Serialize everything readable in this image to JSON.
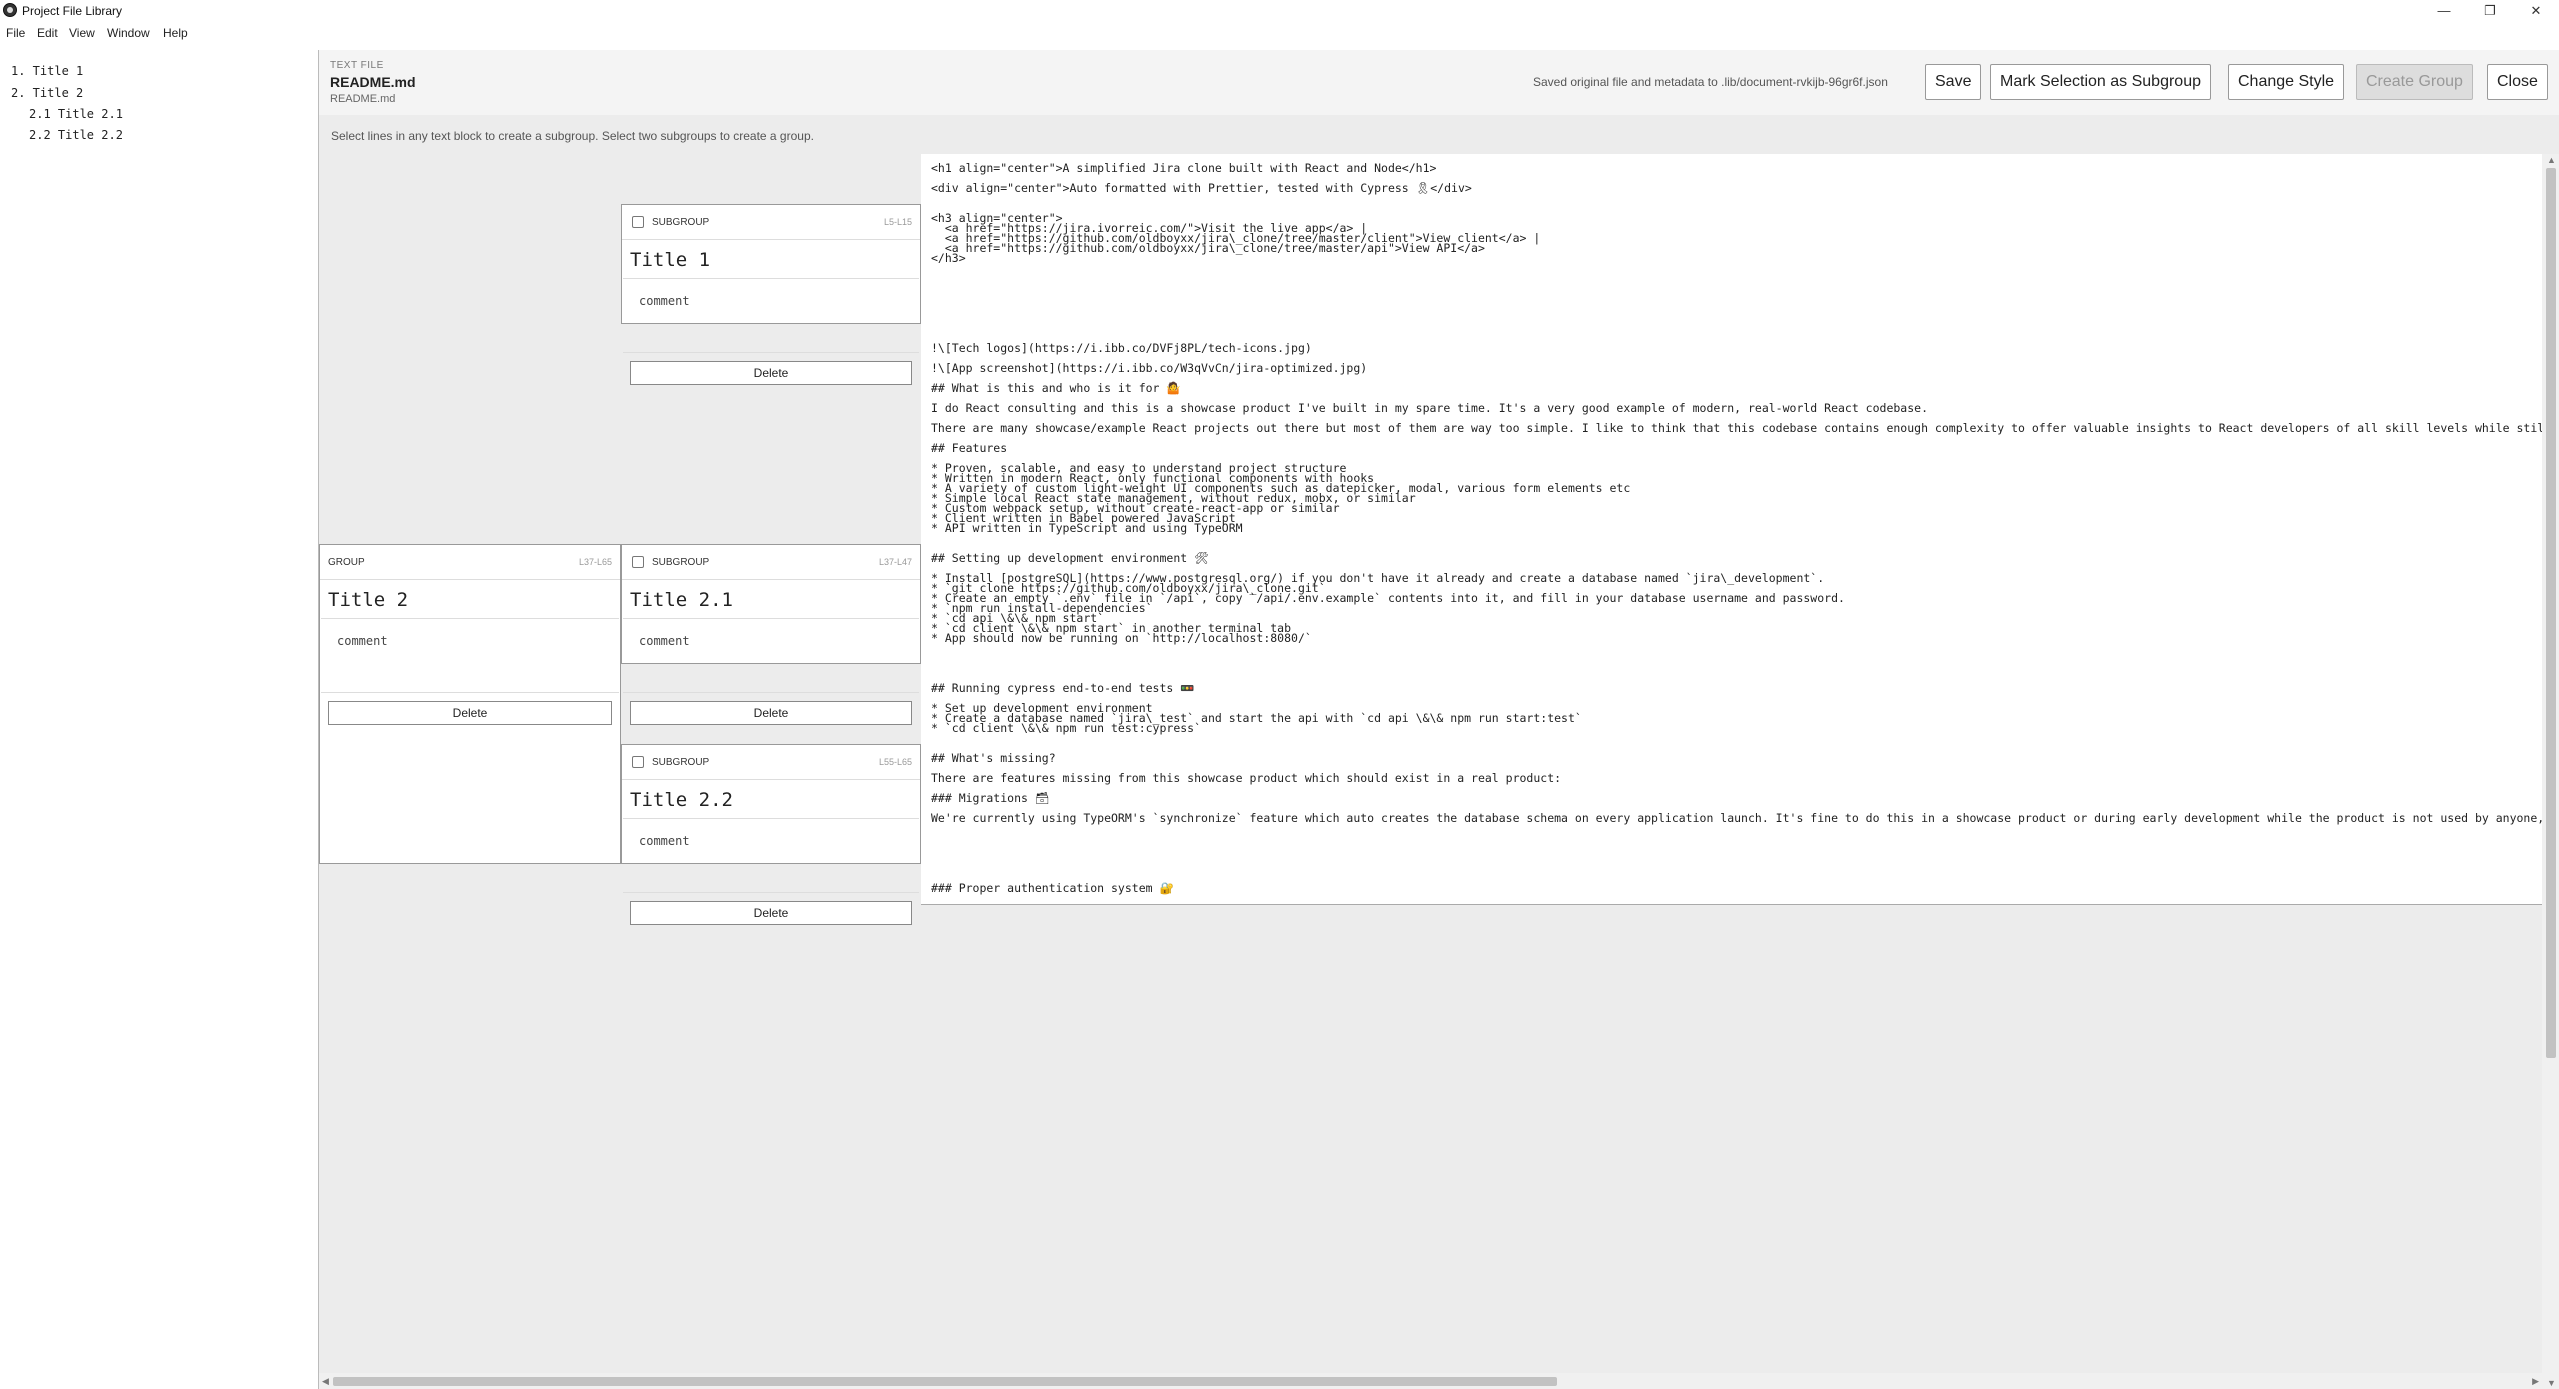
{
  "window": {
    "title": "Project File Library",
    "minimize": "—",
    "maximize": "❐",
    "close": "✕"
  },
  "menu": [
    "File",
    "Edit",
    "View",
    "Window",
    "Help"
  ],
  "toc": [
    "1. Title 1",
    "2. Title 2",
    "2.1 Title 2.1",
    "2.2 Title 2.2"
  ],
  "header": {
    "kind": "TEXT FILE",
    "title": "README.md",
    "subtitle": "README.md",
    "status": "Saved original file and metadata to .lib/document-rvkijb-96gr6f.json",
    "buttons": {
      "save": "Save",
      "mark": "Mark Selection as Subgroup",
      "style": "Change Style",
      "create": "Create Group",
      "close": "Close"
    }
  },
  "hint": "Select lines in any text block to create a subgroup. Select two subgroups to create a group.",
  "blocks": [
    [
      "<h1 align=\"center\">A simplified Jira clone built with React and Node</h1>",
      "",
      "<div align=\"center\">Auto formatted with Prettier, tested with Cypress 🎗</div>"
    ],
    [
      "<h3 align=\"center\">",
      "  <a href=\"https://jira.ivorreic.com/\">Visit the live app</a> |",
      "  <a href=\"https://github.com/oldboyxx/jira\\_clone/tree/master/client\">View client</a> |",
      "  <a href=\"https://github.com/oldboyxx/jira\\_clone/tree/master/api\">View API</a>",
      "</h3>"
    ],
    [
      "",
      "!\\[Tech logos](https://i.ibb.co/DVFj8PL/tech-icons.jpg)",
      "",
      "!\\[App screenshot](https://i.ibb.co/W3qVvCn/jira-optimized.jpg)",
      "",
      "## What is this and who is it for 🤷",
      "",
      "I do React consulting and this is a showcase product I've built in my spare time. It's a very good example of modern, real-world React codebase.",
      "",
      "There are many showcase/example React projects out there but most of them are way too simple. I like to think that this codebase contains enough complexity to offer valuable insights to React developers of all skill levels while still being *re",
      "",
      "## Features",
      "",
      "* Proven, scalable, and easy to understand project structure",
      "* Written in modern React, only functional components with hooks",
      "* A variety of custom light-weight UI components such as datepicker, modal, various form elements etc",
      "* Simple local React state management, without redux, mobx, or similar",
      "* Custom webpack setup, without create-react-app or similar",
      "* Client written in Babel powered JavaScript",
      "* API written in TypeScript and using TypeORM"
    ],
    [
      "## Setting up development environment 🛠",
      "",
      "* Install [postgreSQL](https://www.postgresql.org/) if you don't have it already and create a database named `jira\\_development`.",
      "* `git clone https://github.com/oldboyxx/jira\\_clone.git`",
      "* Create an empty `.env` file in `/api`, copy `/api/.env.example` contents into it, and fill in your database username and password.",
      "* `npm run install-dependencies`",
      "* `cd api \\&\\& npm start`",
      "* `cd client \\&\\& npm start` in another terminal tab",
      "* App should now be running on `http://localhost:8080/`"
    ],
    [
      "",
      "## Running cypress end-to-end tests 🚥",
      "",
      "* Set up development environment",
      "* Create a database named `jira\\_test` and start the api with `cd api \\&\\& npm run start:test`",
      "* `cd client \\&\\& npm run test:cypress`"
    ],
    [
      "## What's missing?",
      "",
      "There are features missing from this showcase product which should exist in a real product:",
      "",
      "### Migrations 🗃",
      "",
      "We're currently using TypeORM's `synchronize` feature which auto creates the database schema on every application launch. It's fine to do this in a showcase product or during early development while the product is not used by anyone, but before"
    ],
    [
      "",
      "### Proper authentication system 🔐"
    ]
  ],
  "cards": [
    {
      "kind": "SUBGROUP",
      "range": "L5-L15",
      "title": "Title 1",
      "comment": "comment",
      "delete": "Delete"
    },
    {
      "kind": "GROUP",
      "range": "L37-L65",
      "title": "Title 2",
      "comment": "comment",
      "delete": "Delete"
    },
    {
      "kind": "SUBGROUP",
      "range": "L37-L47",
      "title": "Title 2.1",
      "comment": "comment",
      "delete": "Delete"
    },
    {
      "kind": "SUBGROUP",
      "range": "L55-L65",
      "title": "Title 2.2",
      "comment": "comment",
      "delete": "Delete"
    }
  ],
  "scroll": {
    "left_arrow": "◀",
    "right_arrow": "▶",
    "up_arrow": "▲",
    "down_arrow": "▼"
  }
}
